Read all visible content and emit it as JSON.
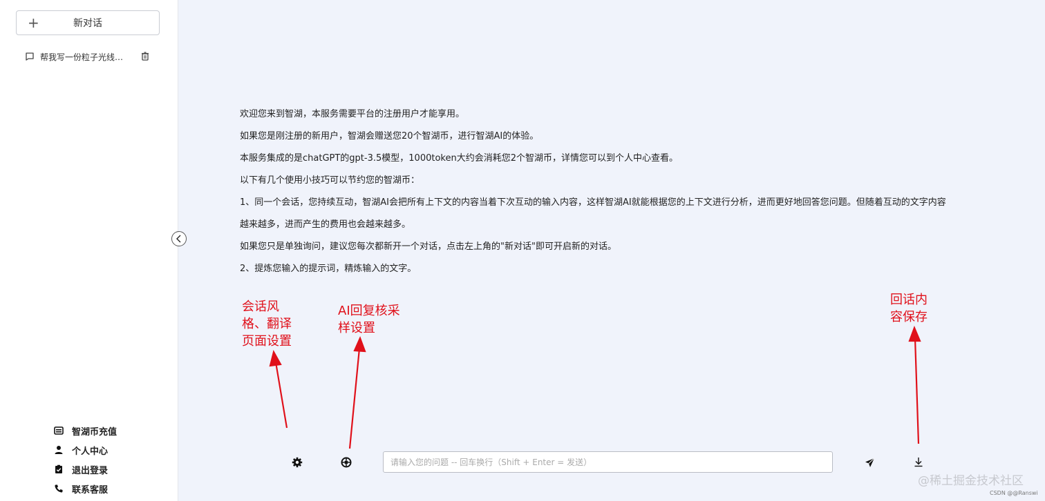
{
  "sidebar": {
    "new_chat_label": "新对话",
    "conversations": [
      {
        "title": "帮我写一份粒子光线…"
      }
    ],
    "menu": [
      {
        "label": "智湖币充值",
        "icon": "wallet-icon"
      },
      {
        "label": "个人中心",
        "icon": "user-icon"
      },
      {
        "label": "退出登录",
        "icon": "clipboard-check-icon"
      },
      {
        "label": "联系客服",
        "icon": "phone-icon"
      }
    ]
  },
  "welcome": {
    "lines": [
      "欢迎您来到智湖，本服务需要平台的注册用户才能享用。",
      "如果您是刚注册的新用户，智湖会赠送您20个智湖币，进行智湖AI的体验。",
      "本服务集成的是chatGPT的gpt-3.5模型，1000token大约会消耗您2个智湖币，详情您可以到个人中心查看。",
      "以下有几个使用小技巧可以节约您的智湖币：",
      "1、同一个会话，您持续互动，智湖AI会把所有上下文的内容当着下次互动的输入内容，这样智湖AI就能根据您的上下文进行分析，进而更好地回答您问题。但随着互动的文字内容",
      "越来越多，进而产生的费用也会越来越多。",
      "如果您只是单独询问，建议您每次都新开一个对话，点击左上角的\"新对话\"即可开启新的对话。",
      "2、提炼您输入的提示词，精炼输入的文字。"
    ]
  },
  "annotations": {
    "style_settings": [
      "会话风",
      "格、翻译",
      "页面设置"
    ],
    "ai_sampling": [
      "AI回复核采",
      "样设置"
    ],
    "save_content": [
      "回话内",
      "容保存"
    ],
    "color": "#e0101a"
  },
  "input": {
    "placeholder": "请输入您的问题 -- 回车换行（Shift + Enter = 发送）",
    "value": ""
  },
  "watermark": {
    "main": "@稀土掘金技术社区",
    "small": "CSDN @@Ranswi"
  }
}
